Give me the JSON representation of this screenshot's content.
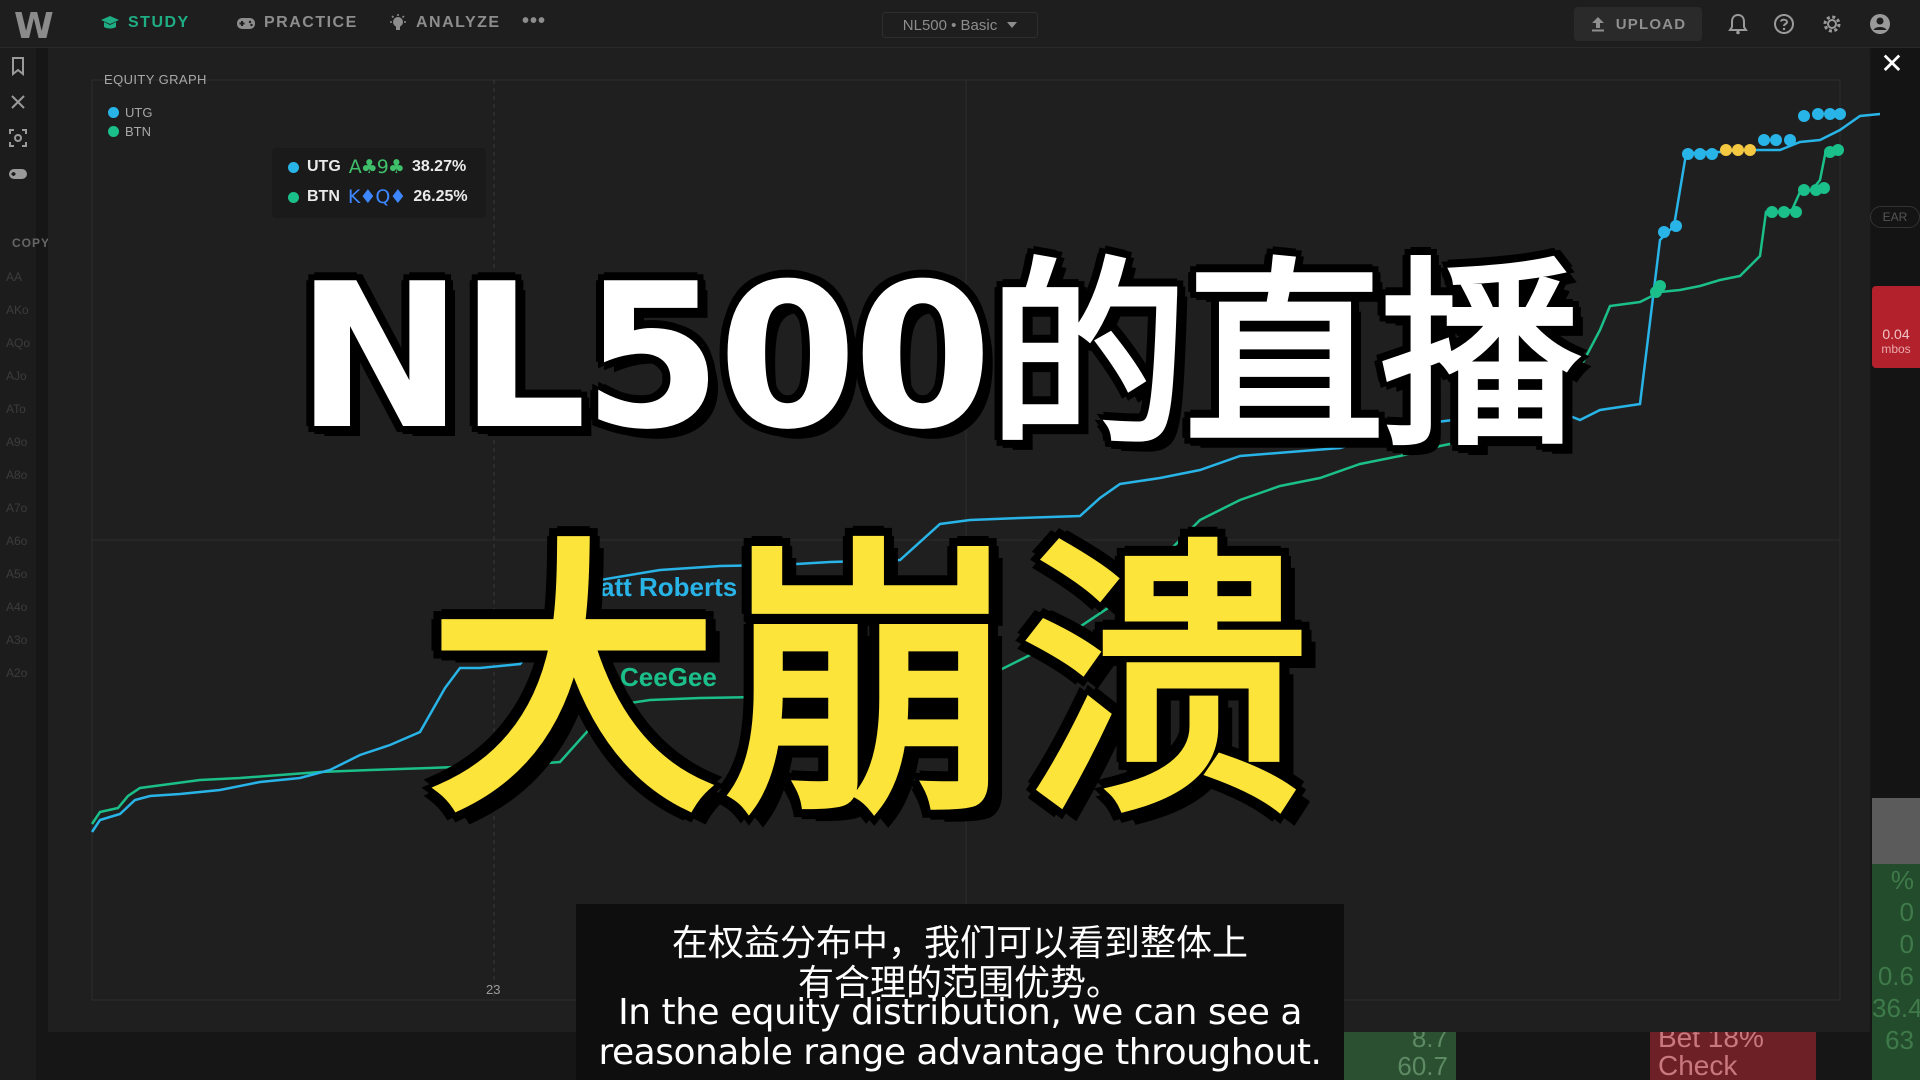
{
  "app": {
    "logo": "W"
  },
  "nav": {
    "study": "STUDY",
    "practice": "PRACTICE",
    "analyze": "ANALYZE",
    "more": "•••",
    "game_select": "NL500 • Basic",
    "upload": "UPLOAD",
    "active_color": "#1fae84"
  },
  "background": {
    "copy_label": "COPY",
    "range_rows": [
      "AA",
      "AKo",
      "AQo",
      "AJo",
      "ATo",
      "A9o",
      "A8o",
      "A7o",
      "A6o",
      "A5o",
      "A4o",
      "A3o",
      "A2o"
    ],
    "clear_label": "EAR",
    "red_card_value": "0.04",
    "red_card_caption": "mbos",
    "green_values": [
      "%",
      "0",
      "0",
      "0.6",
      "36.4",
      "63"
    ],
    "green_cell_values": [
      "8.7",
      "60.7"
    ],
    "bet_check": [
      "Bet 18%",
      "Check"
    ]
  },
  "panel": {
    "title": "EQUITY GRAPH",
    "legend": [
      {
        "name": "UTG",
        "color": "#29b4e8"
      },
      {
        "name": "BTN",
        "color": "#1bbf8a"
      }
    ],
    "tooltip": [
      {
        "position": "UTG",
        "hand": "A♣9♣",
        "hand_color": "#3fbf6a",
        "equity": "38.27%",
        "color": "#29b4e8"
      },
      {
        "position": "BTN",
        "hand": "K♦Q♦",
        "hand_color": "#3d87ff",
        "equity": "26.25%",
        "color": "#1bbf8a"
      }
    ],
    "x_tick": "23",
    "player_labels": [
      {
        "name": "att Roberts",
        "color": "#29b4e8"
      },
      {
        "name": "CeeGee",
        "color": "#1bbf8a"
      }
    ],
    "highlight_color": "#f5c842"
  },
  "overlay": {
    "title_line1": "NL500的直播",
    "title_line2": "大崩溃",
    "title_line1_color": "#ffffff",
    "title_line2_color": "#fde43a"
  },
  "subtitles": {
    "zh_line1": "在权益分布中，我们可以看到整体上",
    "zh_line2": "有合理的范围优势。",
    "en_line1": "In the equity distribution, we can see a",
    "en_line2": "reasonable range advantage throughout."
  }
}
